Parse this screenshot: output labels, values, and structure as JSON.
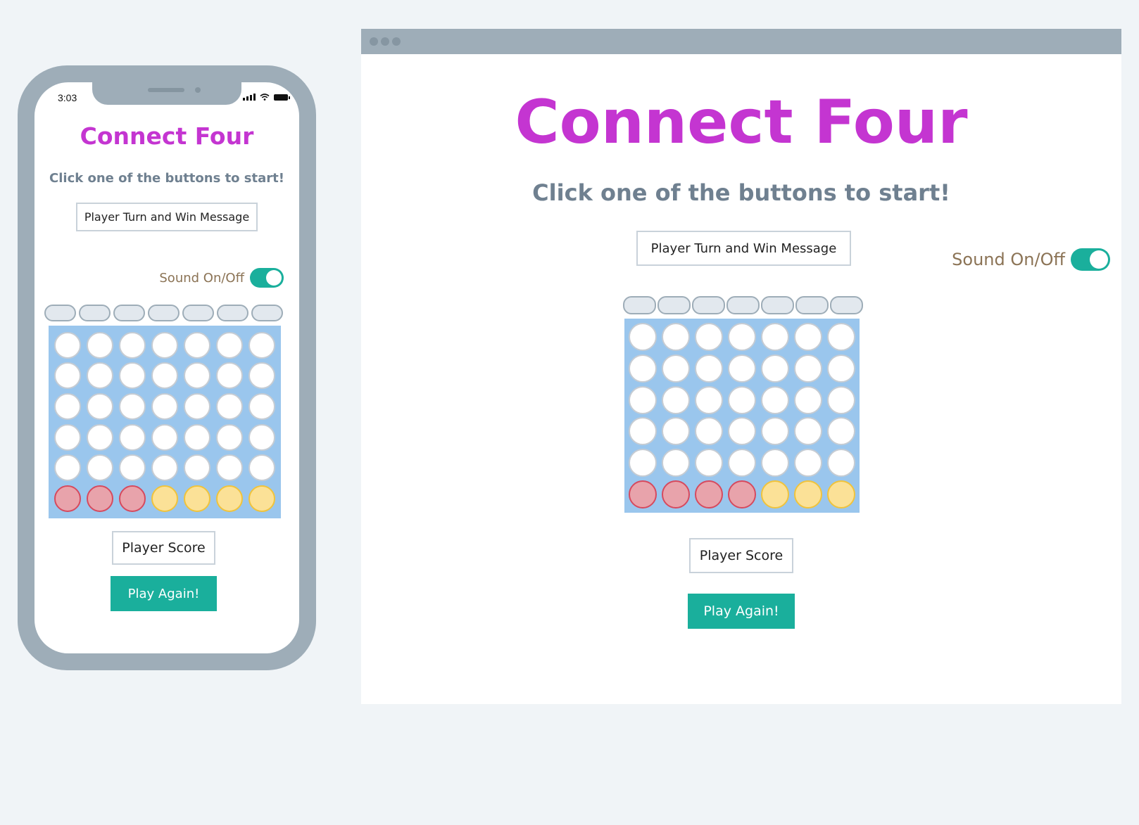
{
  "phone": {
    "status_time": "3:03",
    "title": "Connect Four",
    "subtitle": "Click one of the buttons to start!",
    "message": "Player Turn and Win Message",
    "sound_label": "Sound On/Off",
    "score_label": "Player Score",
    "play_again_label": "Play Again!"
  },
  "desktop": {
    "title": "Connect Four",
    "subtitle": "Click one of the buttons to start!",
    "message": "Player Turn and Win Message",
    "sound_label": "Sound On/Off",
    "score_label": "Player Score",
    "play_again_label": "Play Again!"
  },
  "sound_on": true,
  "board": {
    "columns": 7,
    "rows": 6,
    "cells": [
      [
        "empty",
        "empty",
        "empty",
        "empty",
        "empty",
        "empty",
        "empty"
      ],
      [
        "empty",
        "empty",
        "empty",
        "empty",
        "empty",
        "empty",
        "empty"
      ],
      [
        "empty",
        "empty",
        "empty",
        "empty",
        "empty",
        "empty",
        "empty"
      ],
      [
        "empty",
        "empty",
        "empty",
        "empty",
        "empty",
        "empty",
        "empty"
      ],
      [
        "empty",
        "empty",
        "empty",
        "empty",
        "empty",
        "empty",
        "empty"
      ],
      [
        "red",
        "red",
        "red",
        "yellow",
        "yellow",
        "yellow",
        "yellow"
      ]
    ],
    "desktop_cells": [
      [
        "empty",
        "empty",
        "empty",
        "empty",
        "empty",
        "empty",
        "empty"
      ],
      [
        "empty",
        "empty",
        "empty",
        "empty",
        "empty",
        "empty",
        "empty"
      ],
      [
        "empty",
        "empty",
        "empty",
        "empty",
        "empty",
        "empty",
        "empty"
      ],
      [
        "empty",
        "empty",
        "empty",
        "empty",
        "empty",
        "empty",
        "empty"
      ],
      [
        "empty",
        "empty",
        "empty",
        "empty",
        "empty",
        "empty",
        "empty"
      ],
      [
        "red",
        "red",
        "red",
        "red",
        "yellow",
        "yellow",
        "yellow"
      ]
    ]
  },
  "colors": {
    "title": "#c435d1",
    "accent": "#1aaf9c",
    "board": "#9ac6ed",
    "red_disc": "#e8a3ab",
    "yellow_disc": "#fbe197",
    "frame": "#9eadb8"
  },
  "icons": {
    "signal": "signal-icon",
    "wifi": "wifi-icon",
    "battery": "battery-icon"
  }
}
